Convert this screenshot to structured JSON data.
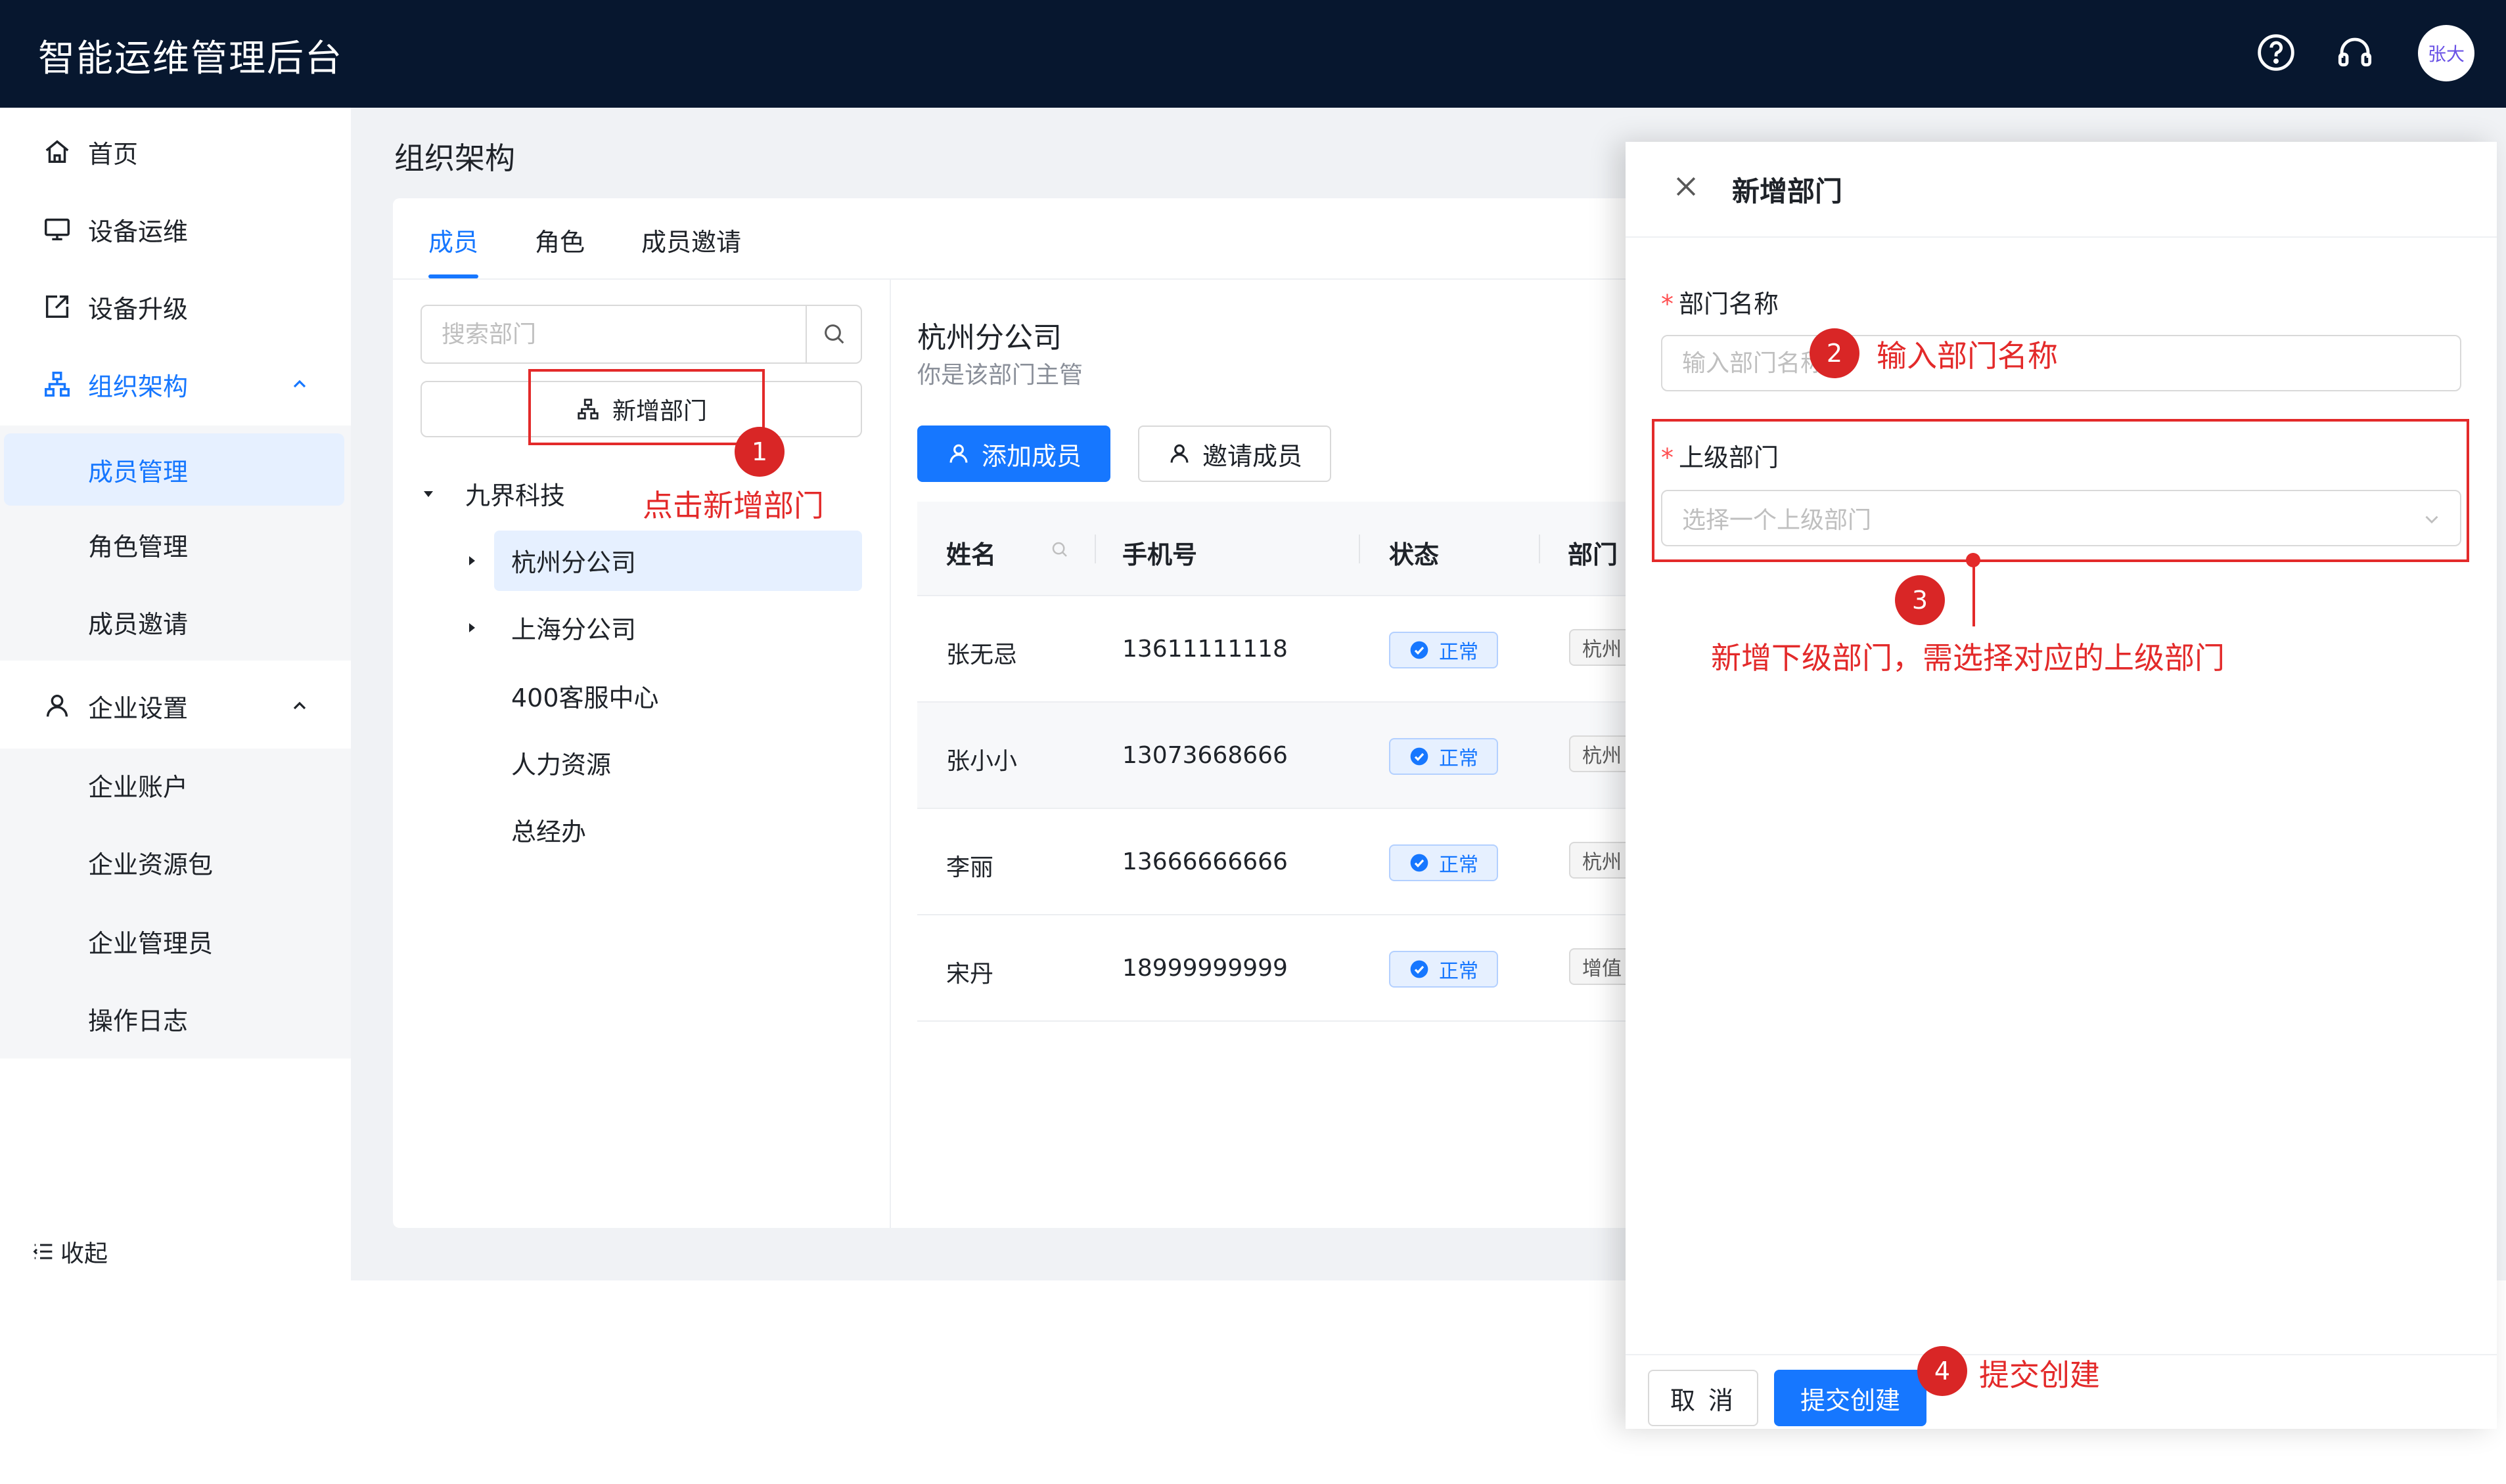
{
  "header": {
    "title": "智能运维管理后台",
    "icons": [
      "help-circle-icon",
      "headset-icon"
    ],
    "user_avatar": "张大"
  },
  "sidebar": {
    "items": [
      {
        "label": "首页",
        "icon": "home-icon"
      },
      {
        "label": "设备运维",
        "icon": "monitor-icon"
      },
      {
        "label": "设备升级",
        "icon": "upgrade-icon"
      },
      {
        "label": "组织架构",
        "icon": "org-chart-icon",
        "expanded": true,
        "active": true,
        "children": [
          {
            "label": "成员管理",
            "selected": true
          },
          {
            "label": "角色管理"
          },
          {
            "label": "成员邀请"
          }
        ]
      },
      {
        "label": "企业设置",
        "icon": "user-icon",
        "expanded": true,
        "children": [
          {
            "label": "企业账户"
          },
          {
            "label": "企业资源包"
          },
          {
            "label": "企业管理员"
          },
          {
            "label": "操作日志"
          }
        ]
      }
    ],
    "collapse_label": "收起"
  },
  "main": {
    "title": "组织架构",
    "tabs": [
      {
        "label": "成员",
        "active": true
      },
      {
        "label": "角色"
      },
      {
        "label": "成员邀请"
      }
    ],
    "dept_search_placeholder": "搜索部门",
    "add_dept_label": "新增部门",
    "tree": [
      {
        "label": "九界科技",
        "expanded": true,
        "children": [
          {
            "label": "杭州分公司",
            "selected": true,
            "has_children": true
          },
          {
            "label": "上海分公司",
            "has_children": true
          },
          {
            "label": "400客服中心"
          },
          {
            "label": "人力资源"
          },
          {
            "label": "总经办"
          }
        ]
      }
    ],
    "current_dept": {
      "name": "杭州分公司",
      "note": "你是该部门主管"
    },
    "buttons": {
      "add_member": "添加成员",
      "invite_member": "邀请成员"
    },
    "table": {
      "headers": [
        "姓名",
        "手机号",
        "状态",
        "部门"
      ],
      "rows": [
        {
          "name": "张无忌",
          "phone": "13611111118",
          "status": "正常",
          "dept": "杭州"
        },
        {
          "name": "张小小",
          "phone": "13073668666",
          "status": "正常",
          "dept": "杭州"
        },
        {
          "name": "李丽",
          "phone": "13666666666",
          "status": "正常",
          "dept": "杭州"
        },
        {
          "name": "宋丹",
          "phone": "18999999999",
          "status": "正常",
          "dept": "增值"
        }
      ]
    }
  },
  "drawer": {
    "title": "新增部门",
    "fields": {
      "dept_name": {
        "label": "部门名称",
        "required_mark": "*",
        "placeholder": "输入部门名称"
      },
      "parent_dept": {
        "label": "上级部门",
        "required_mark": "*",
        "placeholder": "选择一个上级部门"
      }
    },
    "cancel_label": "取 消",
    "submit_label": "提交创建"
  },
  "annotations": [
    {
      "num": "1",
      "text": "点击新增部门"
    },
    {
      "num": "2",
      "text": "输入部门名称"
    },
    {
      "num": "3",
      "text": "新增下级部门，需选择对应的上级部门"
    },
    {
      "num": "4",
      "text": "提交创建"
    }
  ],
  "colors": {
    "header_bg": "#07172f",
    "primary": "#1677ff",
    "annotation": "#e32a2a",
    "page_bg": "#f0f2f5"
  }
}
